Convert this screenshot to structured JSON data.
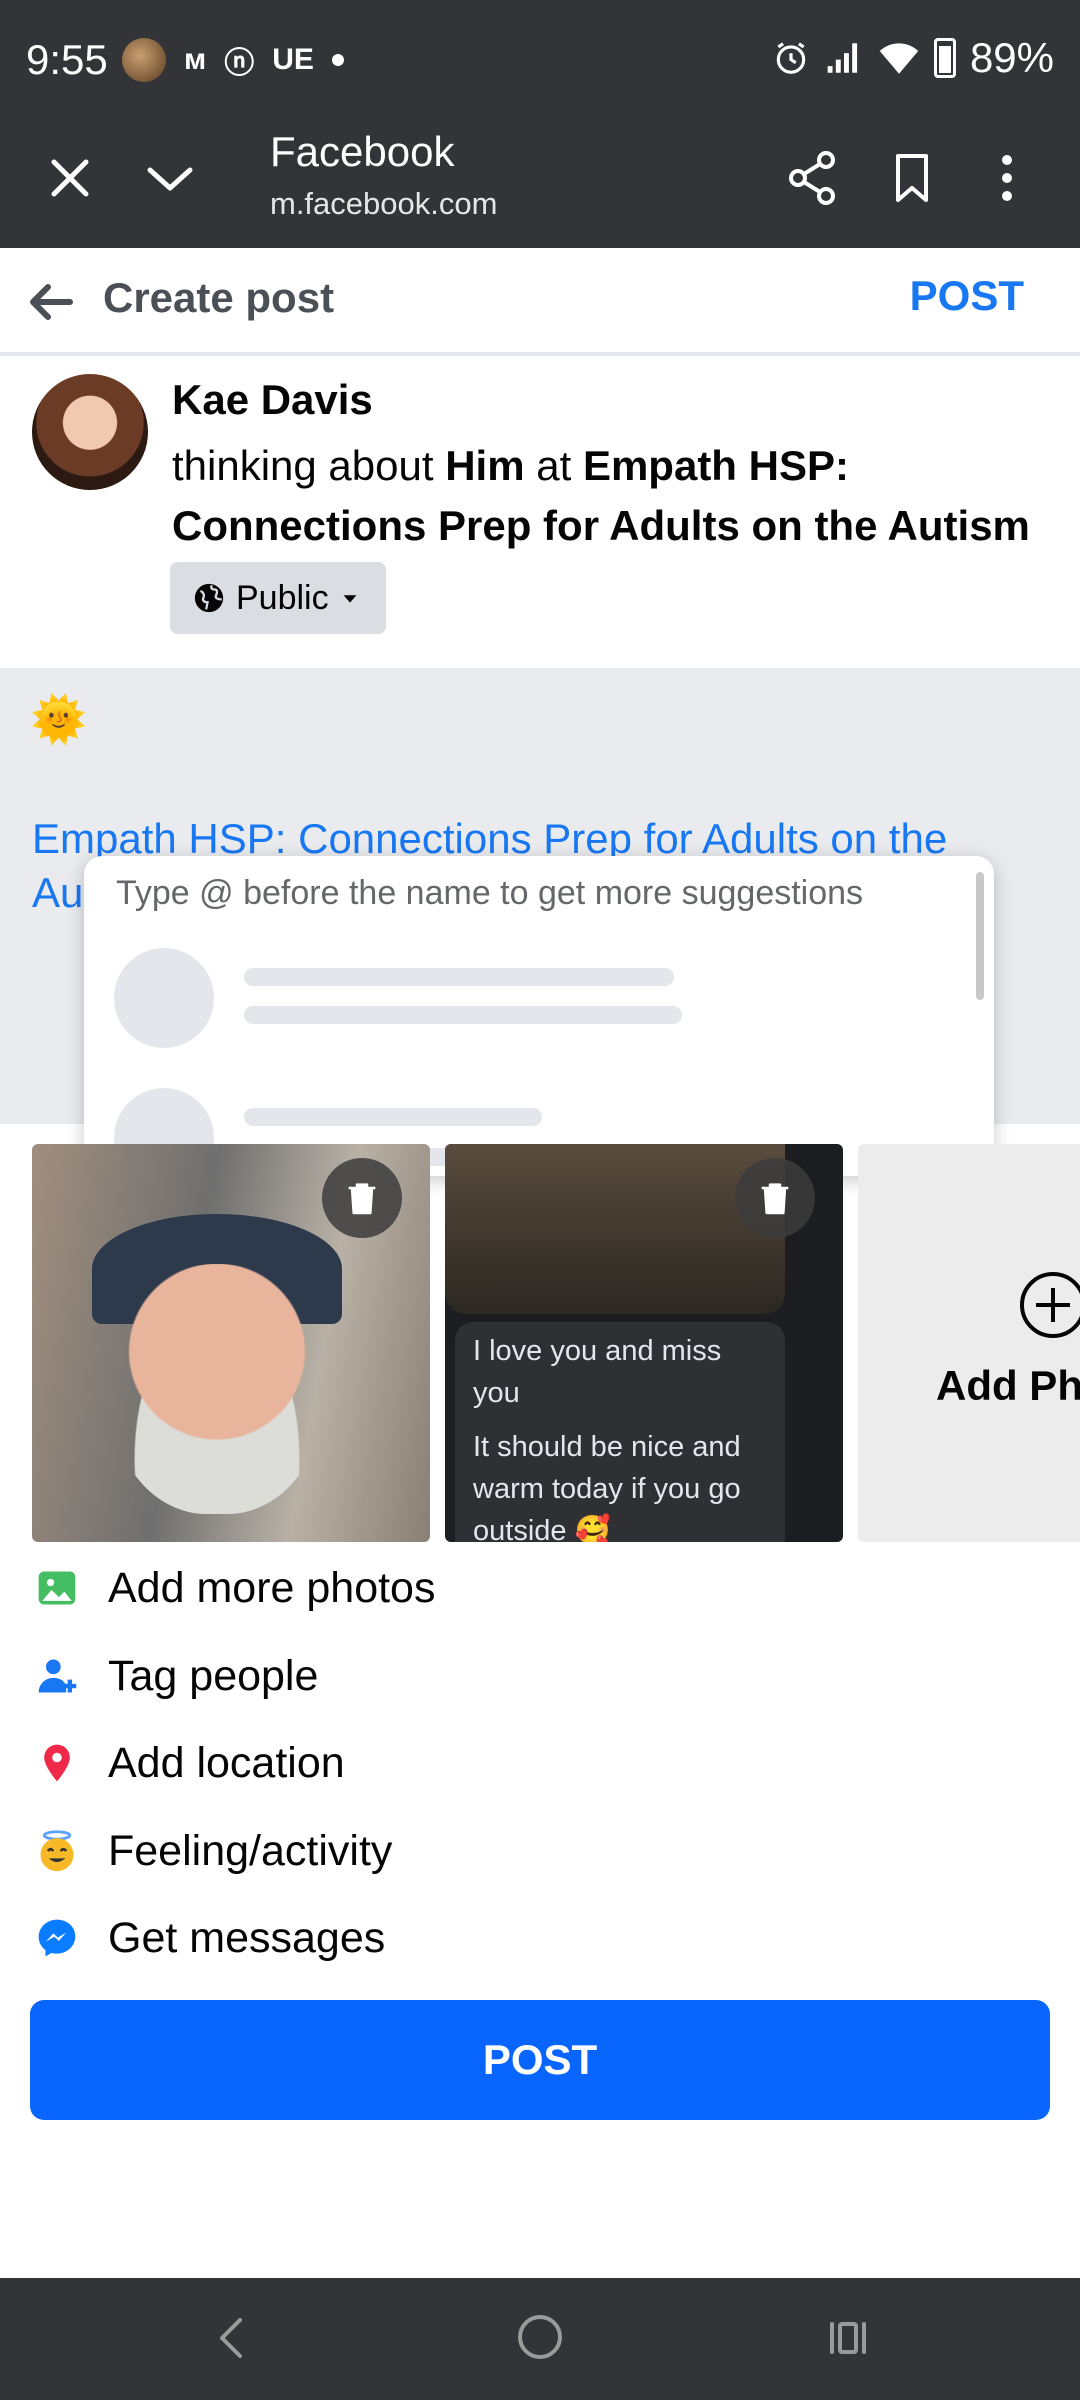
{
  "status_bar": {
    "time": "9:55",
    "notif_icons": [
      "ᴍ",
      "ⓝ",
      "UE"
    ],
    "battery": "89%"
  },
  "browser_bar": {
    "title": "Facebook",
    "url": "m.facebook.com"
  },
  "header": {
    "title": "Create post",
    "post_label": "POST"
  },
  "composer": {
    "author_name": "Kae Davis",
    "status_prefix": "thinking about ",
    "status_person": "Him",
    "status_mid": " at ",
    "status_group": "Empath HSP: Connections Prep for Adults on the Autism Spectrum",
    "status_suffix": ".",
    "privacy_label": "Public",
    "emoji": "🌞",
    "link_text": "Empath HSP: Connections Prep for Adults on the Autism Spectrum"
  },
  "suggestions": {
    "hint": "Type @ before the name to get more suggestions"
  },
  "photos": {
    "chat_lines": [
      "I love you and miss you",
      "💍",
      "It should be nice and warm today if you go outside 🥰"
    ],
    "add_label": "Add Photo"
  },
  "actions": [
    {
      "label": "Add more photos",
      "icon": "photo-icon",
      "color": "#45bd62"
    },
    {
      "label": "Tag people",
      "icon": "tag-people-icon",
      "color": "#1877f2"
    },
    {
      "label": "Add location",
      "icon": "location-pin-icon",
      "color": "#f02849"
    },
    {
      "label": "Feeling/activity",
      "icon": "smile-halo-icon",
      "color": "#f7b928"
    },
    {
      "label": "Get messages",
      "icon": "messenger-icon",
      "color": "#0a7cff"
    }
  ],
  "post_button": "POST",
  "colors": {
    "accent": "#1877f2",
    "post_button": "#0866ff",
    "status_bar": "#333437"
  }
}
